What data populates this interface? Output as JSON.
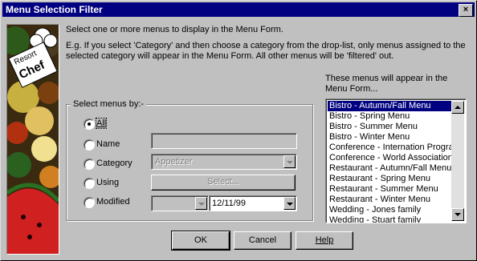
{
  "window": {
    "title": "Menu Selection Filter",
    "close_glyph": "×"
  },
  "logo": {
    "line1": "Resort",
    "line2": "Chef"
  },
  "intro": {
    "line1": "Select one or more menus to display in the Menu Form.",
    "line2a": "E.g. If you select 'Category' and then choose a category from the drop-list, only menus assigned to the",
    "line2b": "selected category will appear in the Menu Form. All other menus will be 'filtered' out."
  },
  "group": {
    "label": "Select menus by:-",
    "options": [
      {
        "label": "All",
        "selected": true
      },
      {
        "label": "Name",
        "selected": false
      },
      {
        "label": "Category",
        "selected": false
      },
      {
        "label": "Using",
        "selected": false
      },
      {
        "label": "Modified",
        "selected": false
      }
    ],
    "name_value": "",
    "category_value": "Appetizer",
    "using_button": "Select...",
    "modified_op": "",
    "modified_date": "12/11/99"
  },
  "list": {
    "heading1": "These menus will appear in the",
    "heading2": "Menu Form...",
    "items": [
      "Bistro - Autumn/Fall Menu",
      "Bistro - Spring Menu",
      "Bistro - Summer Menu",
      "Bistro - Winter Menu",
      "Conference - Internation Program",
      "Conference - World Association",
      "Restaurant - Autumn/Fall Menu",
      "Restaurant - Spring Menu",
      "Restaurant - Summer Menu",
      "Restaurant - Winter Menu",
      "Wedding - Jones family",
      "Wedding - Stuart family"
    ],
    "selected_index": 0
  },
  "buttons": {
    "ok": "OK",
    "cancel": "Cancel",
    "help": "Help"
  }
}
